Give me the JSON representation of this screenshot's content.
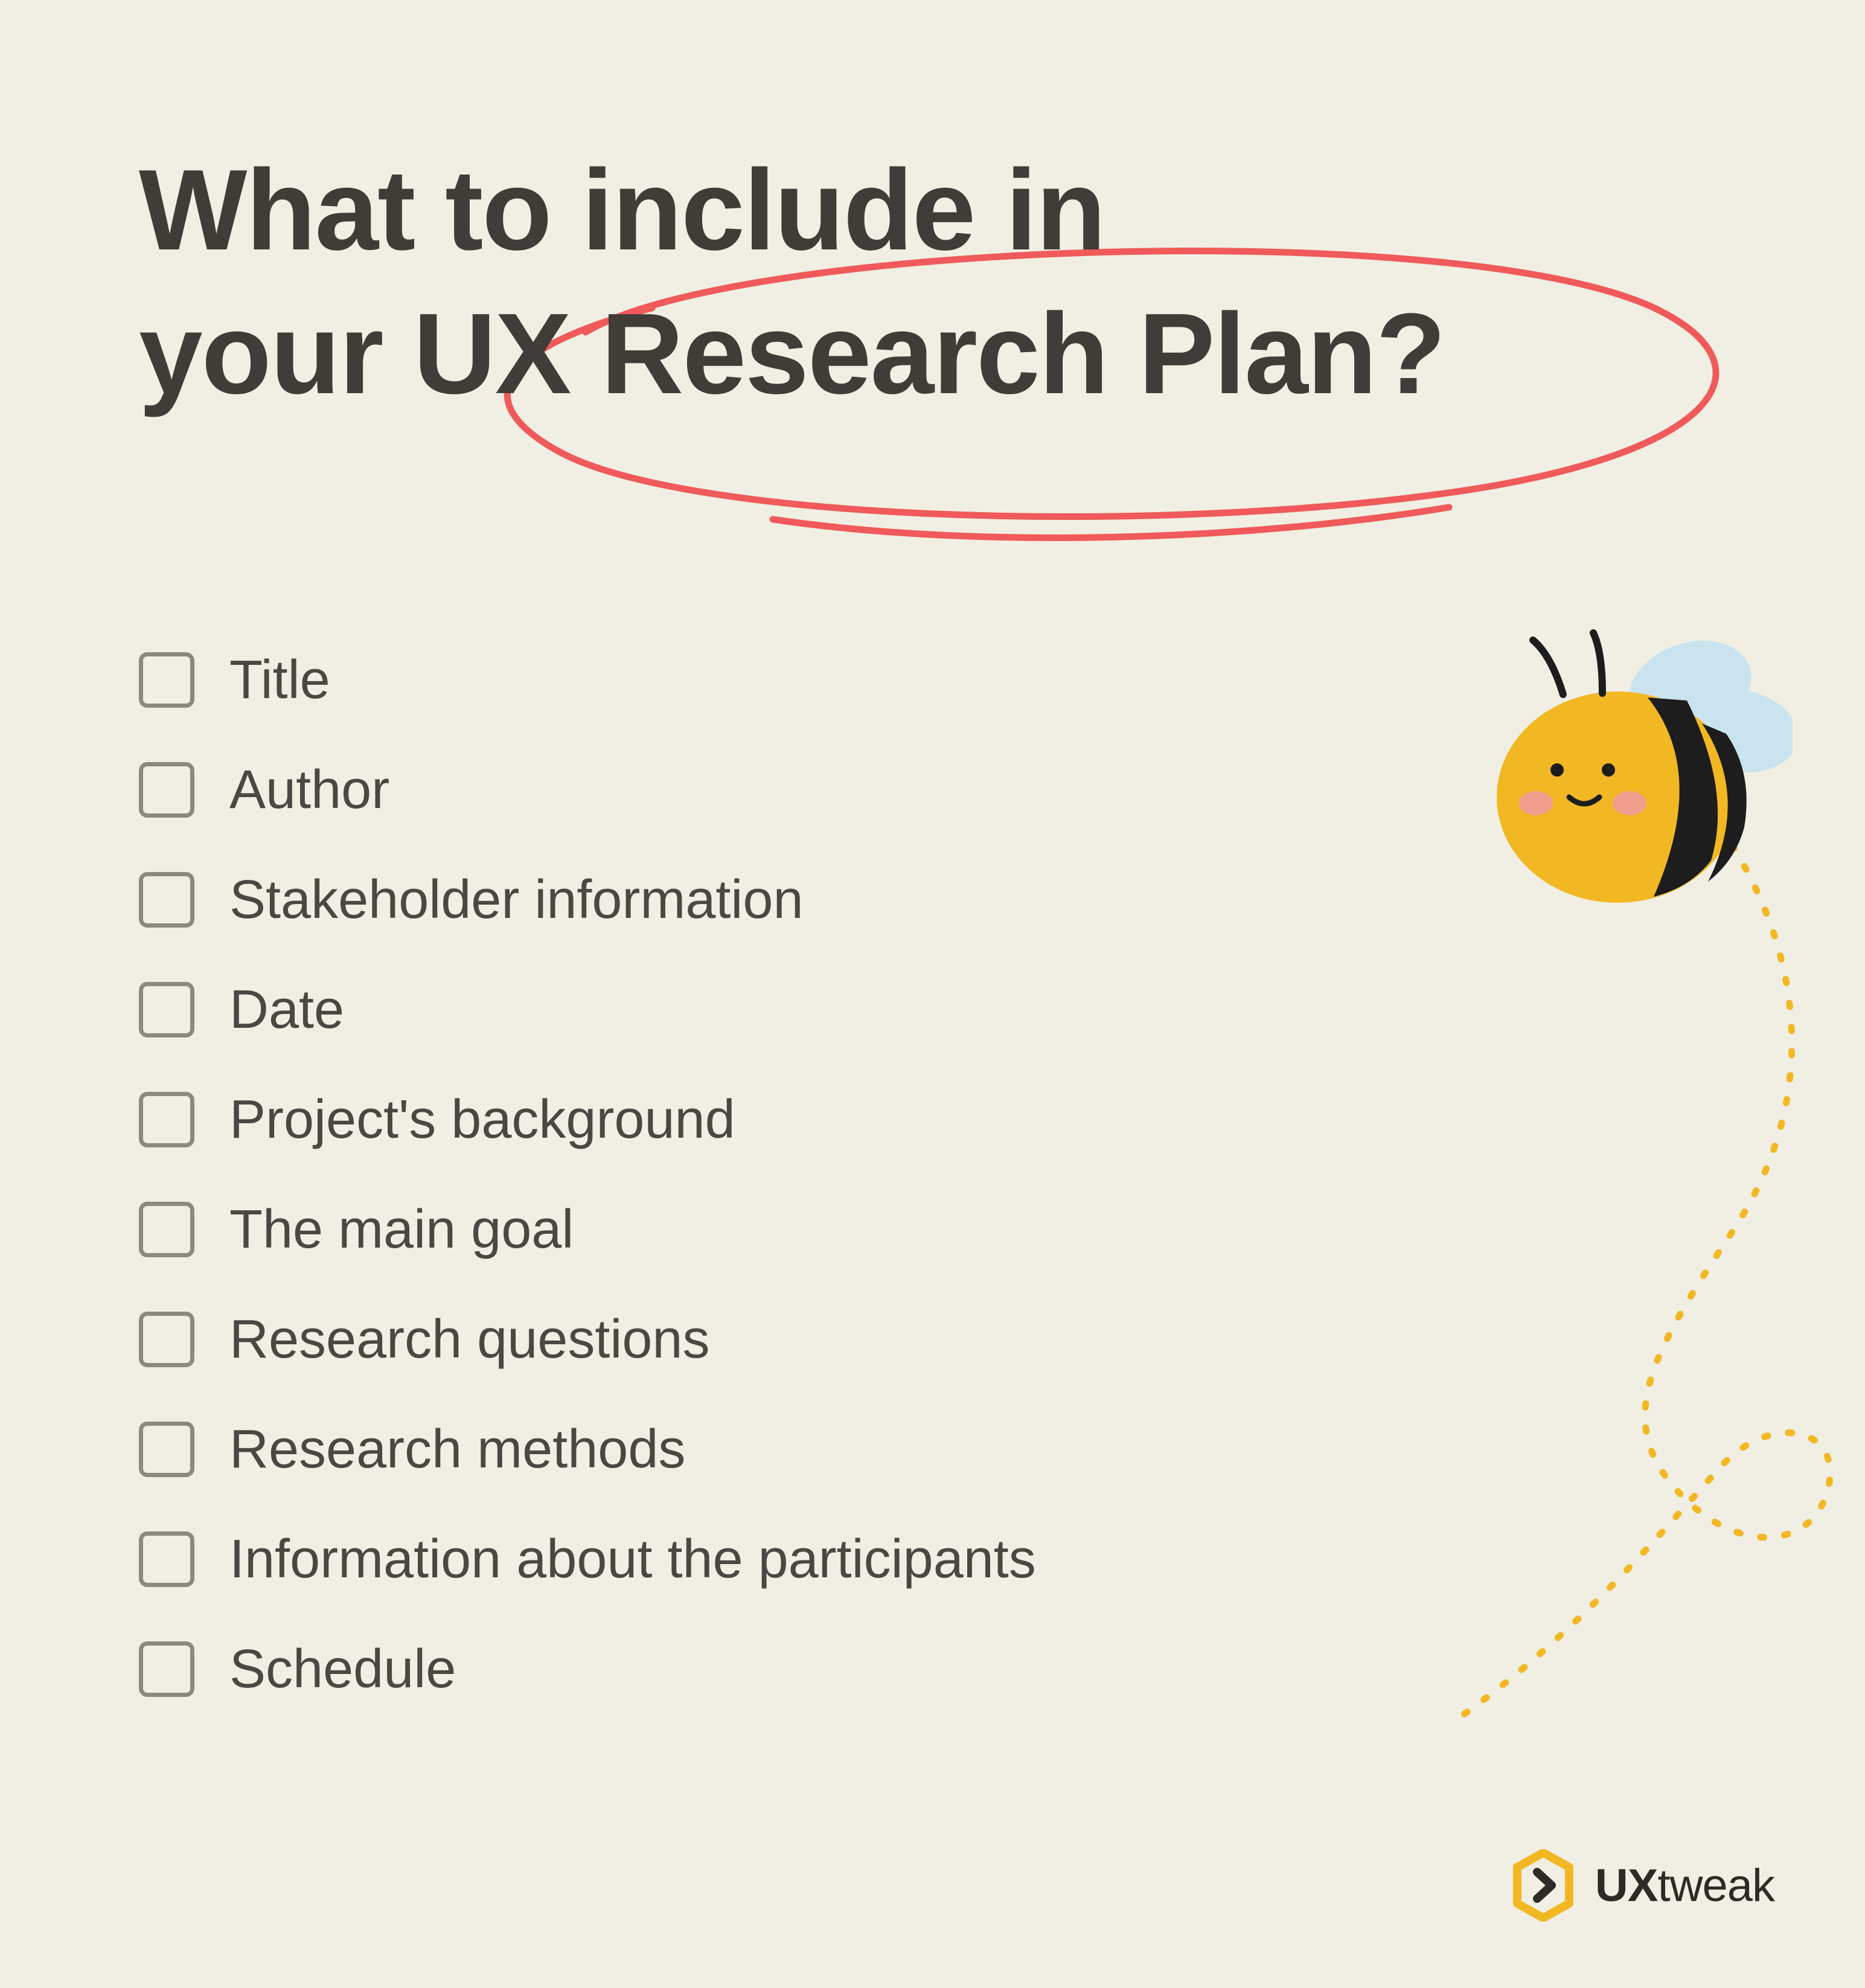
{
  "heading": {
    "line1": "What to include in",
    "line2_pre": "your ",
    "line2_highlight": "UX Research Plan?"
  },
  "checklist": [
    "Title",
    "Author",
    "Stakeholder information",
    "Date",
    "Project's background",
    "The main goal",
    "Research questions",
    "Research methods",
    "Information about the participants",
    "Schedule"
  ],
  "brand": {
    "bold": "UX",
    "light": "tweak"
  },
  "colors": {
    "background": "#f1efe4",
    "text_heading": "#403d39",
    "text_body": "#4b4844",
    "checkbox_border": "#8d8981",
    "circle_stroke": "#f05a5a",
    "bee_yellow": "#f2b824",
    "bee_wing": "#c9e3ef",
    "bee_stripe": "#1d1d1d",
    "bee_blush": "#f29e8e",
    "path_dash": "#f2b824",
    "logo_accent": "#f2b824"
  }
}
